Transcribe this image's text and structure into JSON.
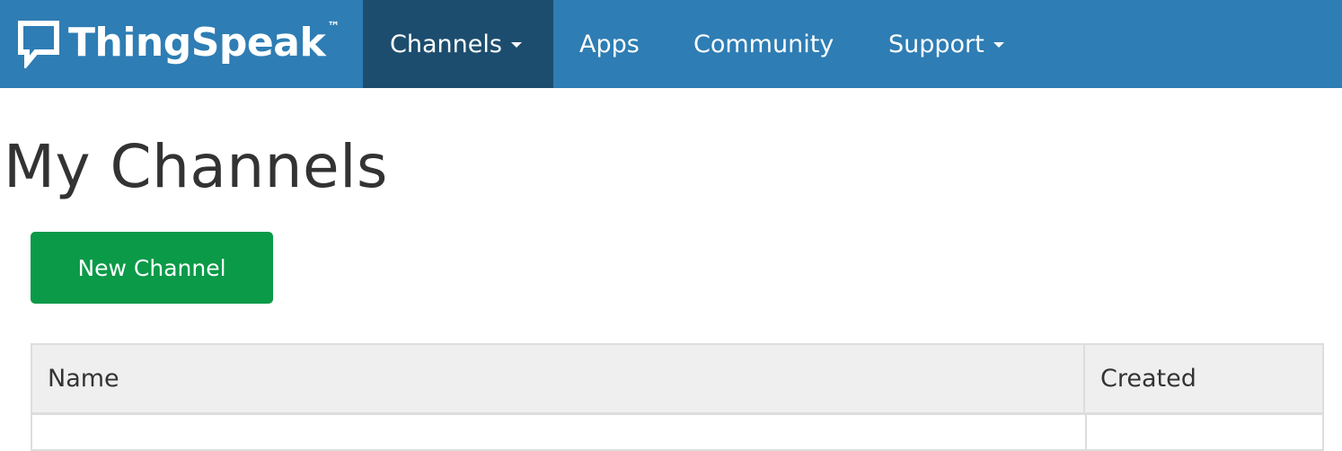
{
  "navbar": {
    "brand": "ThingSpeak",
    "trademark": "™",
    "items": [
      {
        "label": "Channels",
        "has_caret": true,
        "active": true
      },
      {
        "label": "Apps",
        "has_caret": false,
        "active": false
      },
      {
        "label": "Community",
        "has_caret": false,
        "active": false
      },
      {
        "label": "Support",
        "has_caret": true,
        "active": false
      }
    ],
    "colors": {
      "background": "#2e7db4",
      "active": "#1d4d6e"
    }
  },
  "main": {
    "title": "My Channels",
    "new_channel_label": "New Channel",
    "new_channel_color": "#0a9a48",
    "table": {
      "columns": [
        "Name",
        "Created"
      ]
    }
  }
}
